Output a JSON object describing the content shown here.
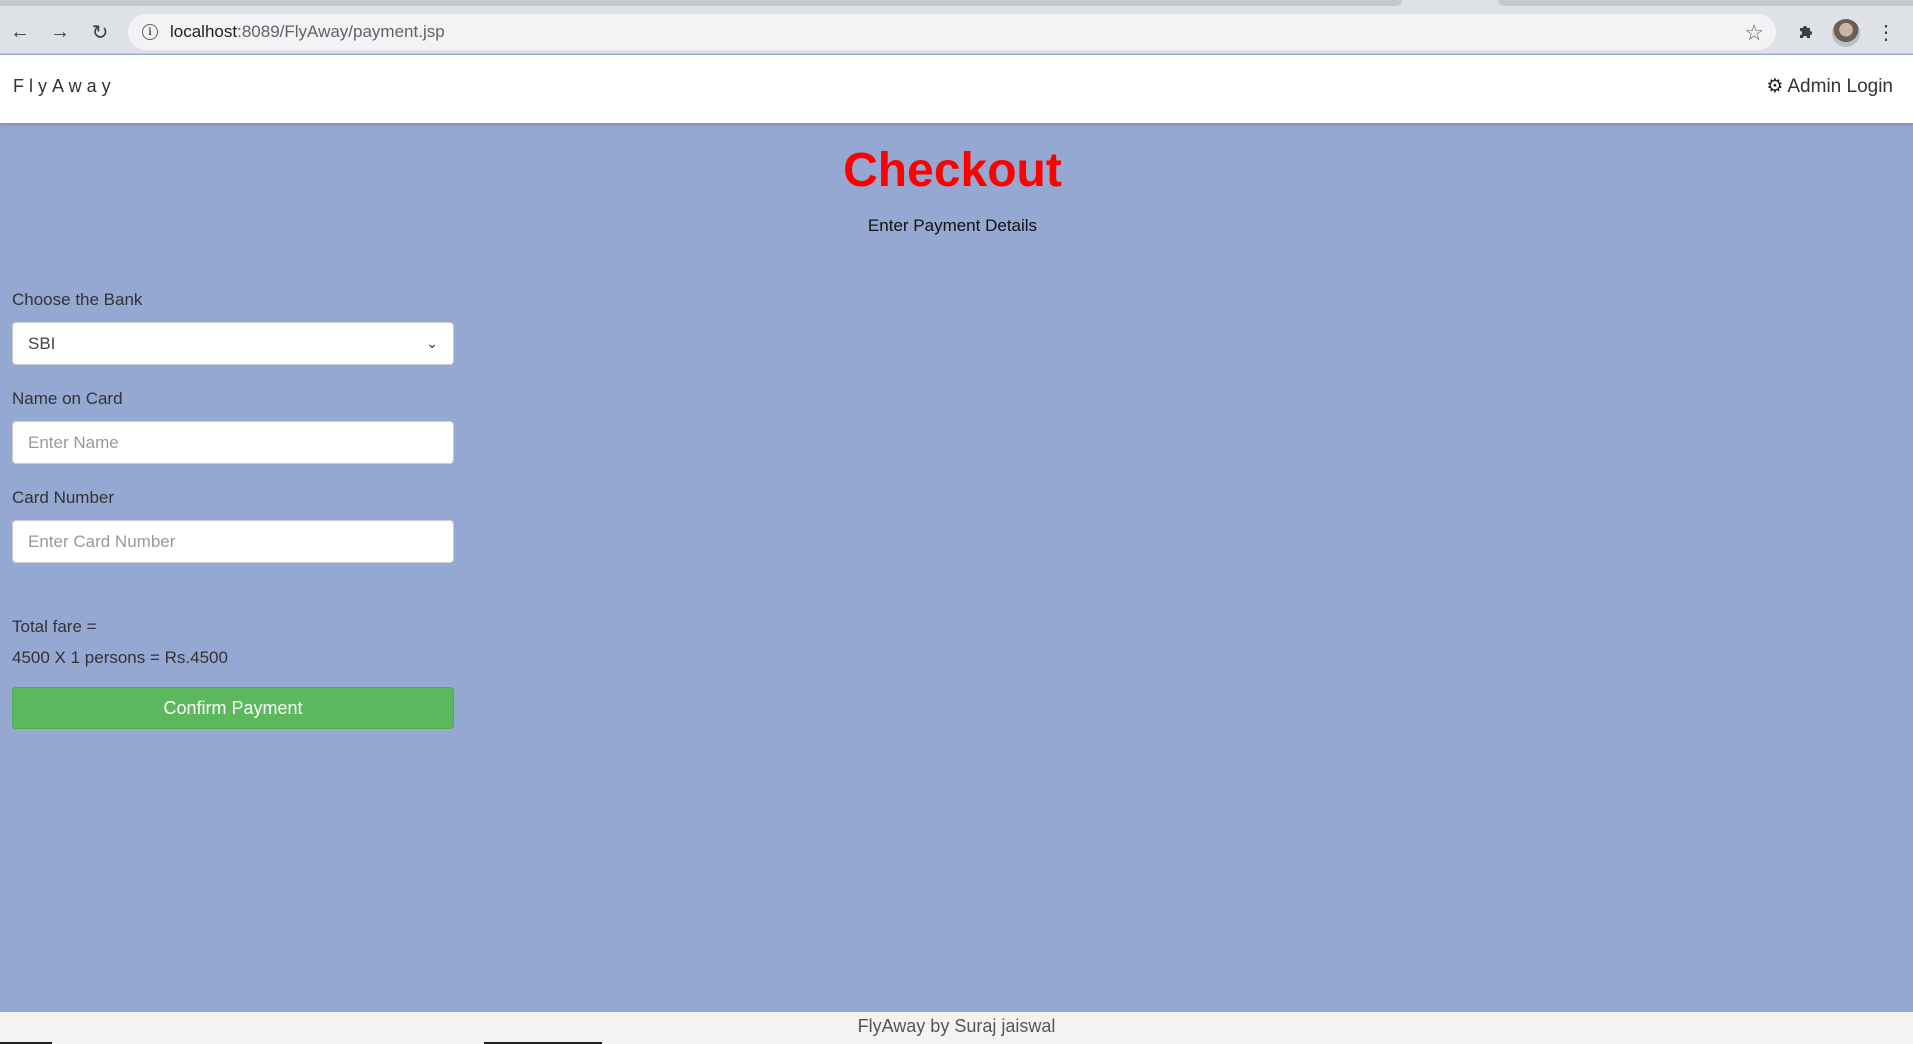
{
  "browser": {
    "url_host": "localhost",
    "url_path": ":8089/FlyAway/payment.jsp"
  },
  "navbar": {
    "brand": "FlyAway",
    "admin_login": "Admin Login"
  },
  "main": {
    "title": "Checkout",
    "subtitle": "Enter Payment Details"
  },
  "form": {
    "bank_label": "Choose the Bank",
    "bank_selected": "SBI",
    "name_label": "Name on Card",
    "name_placeholder": "Enter Name",
    "card_label": "Card Number",
    "card_placeholder": "Enter Card Number"
  },
  "fare": {
    "title": "Total fare =",
    "calculation": "4500 X 1 persons = Rs.4500"
  },
  "confirm_label": "Confirm Payment",
  "footer": "FlyAway by Suraj jaiswal",
  "colors": {
    "page_bg": "#94a8d2",
    "title": "#ff0000",
    "button": "#5cb85c"
  }
}
